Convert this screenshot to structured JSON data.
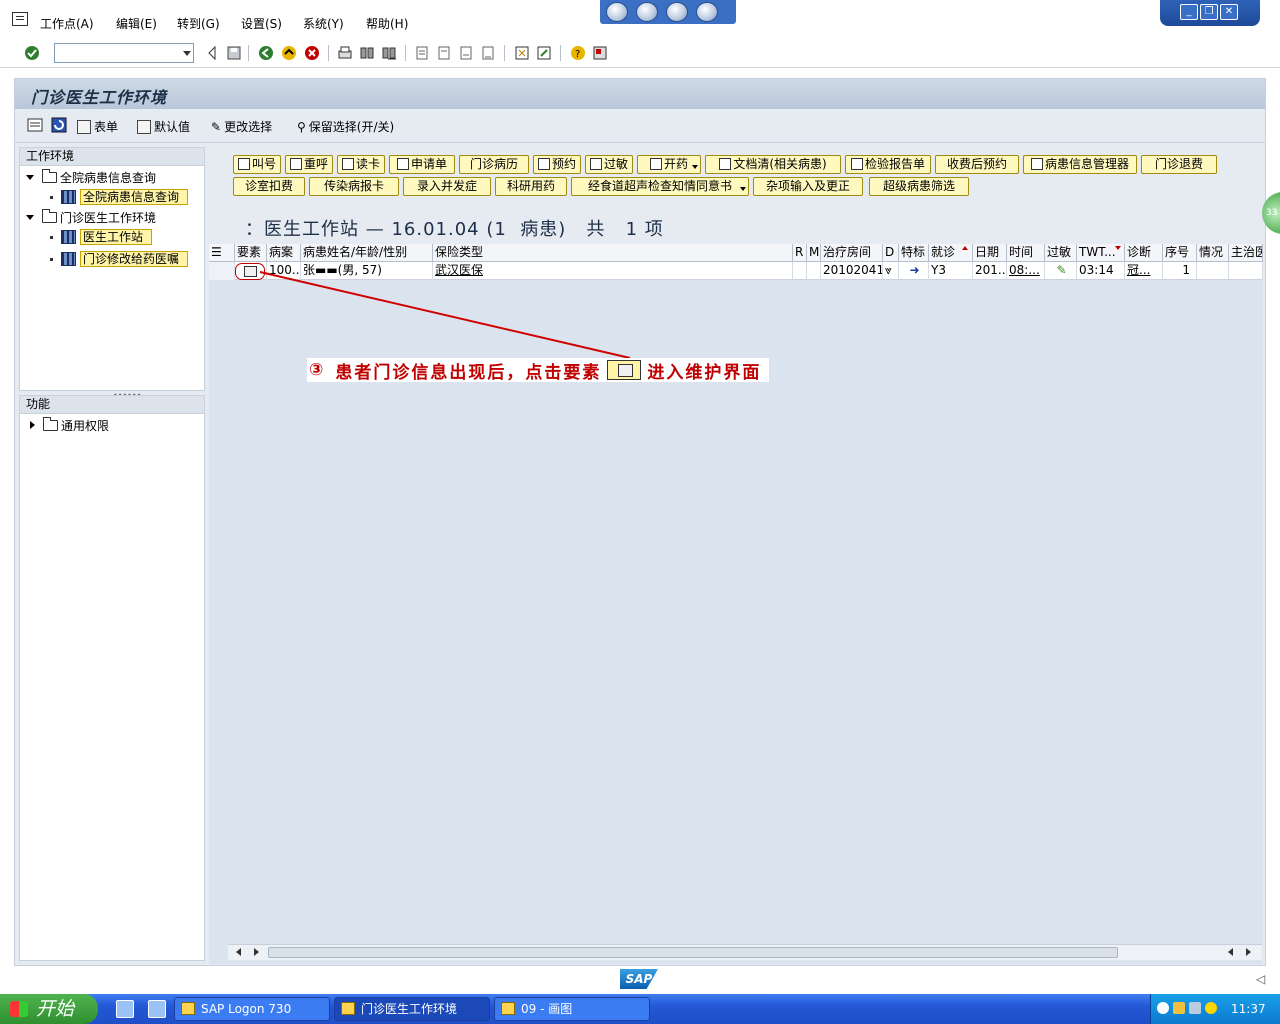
{
  "menubar": {
    "items": [
      "工作点(A)",
      "编辑(E)",
      "转到(G)",
      "设置(S)",
      "系统(Y)",
      "帮助(H)"
    ]
  },
  "window_controls": [
    "_",
    "❐",
    "✕"
  ],
  "page_title": "门诊医生工作环境",
  "app_toolbar": {
    "table_label": "表单",
    "default_label": "默认值",
    "change_selection_label": "更改选择",
    "keep_selection_label": "保留选择(开/关)"
  },
  "tree": {
    "header": "工作环境",
    "nodes": [
      {
        "label": "全院病患信息查询"
      },
      {
        "label": "全院病患信息查询"
      },
      {
        "label": "门诊医生工作环境"
      },
      {
        "label": "医生工作站"
      },
      {
        "label": "门诊修改给药医嘱"
      }
    ]
  },
  "function_panel": {
    "header": "功能",
    "items": [
      "通用权限"
    ]
  },
  "action_buttons_row1": [
    "叫号",
    "重呼",
    "读卡",
    "申请单",
    "门诊病历",
    "预约",
    "过敏",
    "开药",
    "文档清(相关病患)",
    "检验报告单",
    "收费后预约",
    "病患信息管理器",
    "门诊退费"
  ],
  "action_buttons_row2": [
    "诊室扣费",
    "传染病报卡",
    "录入并发症",
    "科研用药",
    "经食道超声检查知情同意书",
    "杂项输入及更正",
    "超级病患筛选"
  ],
  "list_title": "：医生工作站 — 16.01.04 (1  病患)   共   1 项",
  "grid": {
    "headers": [
      "要素",
      "病案",
      "病患姓名/年龄/性别",
      "保险类型",
      "R",
      "M",
      "治疗房间",
      "D",
      "特标",
      "就诊",
      "日期",
      "时间",
      "过敏",
      "TWT...",
      "诊断",
      "序号",
      "情况",
      "主治医"
    ],
    "row": {
      "case_no": "100...",
      "patient": "张▬▬(男, 57)",
      "insurance": "武汉医保",
      "room": "20102041",
      "visit": "Y3",
      "date": "201...",
      "time": "08:...",
      "twt": "03:14",
      "diagnosis": "冠...",
      "seq": "1"
    }
  },
  "annotation": {
    "circle_num": "③",
    "text_before": "患者门诊信息出现后，点击要素",
    "text_after": "进入维护界面"
  },
  "status": {
    "logo": "SAP",
    "side_badge": "33"
  },
  "taskbar": {
    "start": "开始",
    "tasks": [
      "SAP Logon 730",
      "门诊医生工作环境",
      "09 - 画图"
    ],
    "clock": "11:37"
  },
  "colors": {
    "accent_red": "#c00000",
    "button_yellow": "#fff9bf",
    "frame_bg": "#e6ebf2",
    "taskbar_blue": "#2457d6"
  }
}
